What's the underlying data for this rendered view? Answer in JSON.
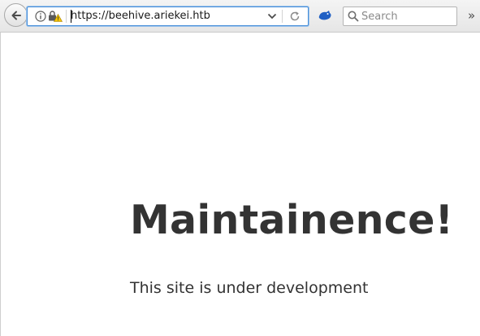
{
  "toolbar": {
    "back_icon": "arrow-left-icon",
    "site_info_icon": "info-icon",
    "security_icon": "lock-warning-icon",
    "url": "https://beehive.ariekei.htb",
    "dropdown_icon": "chevron-down-icon",
    "reload_icon": "reload-icon",
    "extension_icon": "extension-icon",
    "search": {
      "placeholder": "Search",
      "value": ""
    },
    "overflow_label": "»"
  },
  "page": {
    "headline": "Maintainence!",
    "subtext": "This site is under development"
  },
  "colors": {
    "text": "#333333",
    "url_focus_border": "#4a90d9",
    "warning": "#f5c400"
  }
}
